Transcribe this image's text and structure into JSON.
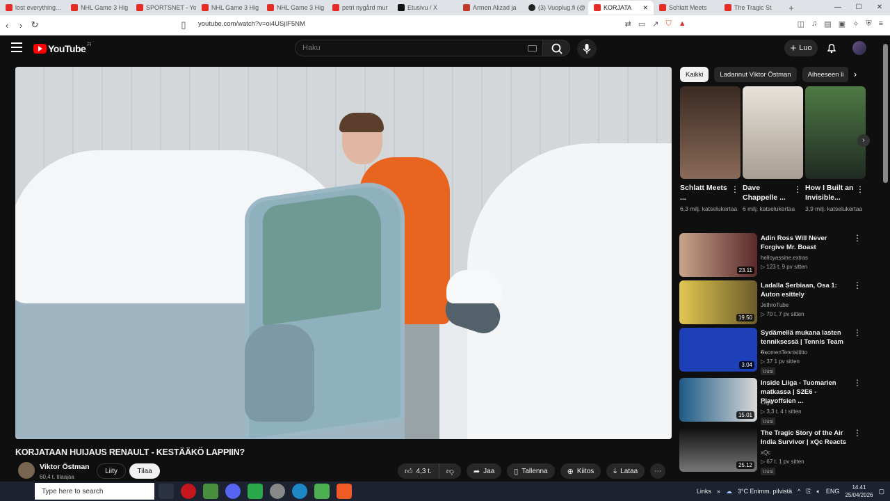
{
  "browser": {
    "tabs": [
      {
        "label": "lost everything...",
        "icon": "youtube-icon"
      },
      {
        "label": "NHL Game 3 Hig",
        "icon": "youtube-icon"
      },
      {
        "label": "SPORTSNET - You",
        "icon": "youtube-icon"
      },
      {
        "label": "NHL Game 3 Hig",
        "icon": "youtube-icon"
      },
      {
        "label": "NHL Game 3 Hig",
        "icon": "youtube-icon"
      },
      {
        "label": "petri nygård mur",
        "icon": "youtube-icon"
      },
      {
        "label": "Etusivu / X",
        "icon": "x-icon"
      },
      {
        "label": "Armen Alizad ja",
        "icon": "a-icon"
      },
      {
        "label": "(3) Vuoplug.fi (@",
        "icon": "tiktok-icon"
      },
      {
        "label": "KORJATA",
        "icon": "youtube-icon",
        "active": true
      },
      {
        "label": "Schlatt Meets",
        "icon": "youtube-icon"
      },
      {
        "label": "The Tragic St",
        "icon": "youtube-icon"
      }
    ],
    "url": "youtube.com/watch?v=oi4USjIF5NM"
  },
  "header": {
    "logo_text": "YouTube",
    "country_code": "FI",
    "search_placeholder": "Haku",
    "create_label": "Luo"
  },
  "video": {
    "title": "KORJATAAN HUIJAUS RENAULT - KESTÄÄKÖ LAPPIIN?",
    "channel": "Viktor Östman",
    "subscribers": "60,4 t. tilaajaa",
    "join_label": "Liity",
    "subscribe_label": "Tilaa",
    "likes": "4,3 t.",
    "share_label": "Jaa",
    "save_label": "Tallenna",
    "thanks_label": "Kiitos",
    "download_label": "Lataa"
  },
  "chips": [
    "Kaikki",
    "Ladannut Viktor Östman",
    "Aiheeseen li"
  ],
  "shorts": [
    {
      "title": "Schlatt Meets ...",
      "views": "6,3 milj. katselukertaa",
      "color": "#6b4a3a"
    },
    {
      "title": "Dave Chappelle ...",
      "views": "6 milj. katselukertaa",
      "color": "#d9d4cc"
    },
    {
      "title": "How I Built an Invisible...",
      "views": "3,9 milj. katselukertaa",
      "color": "#3c5a3a"
    }
  ],
  "recommendations": [
    {
      "title": "Adin Ross Will Never Forgive Mr. Boast",
      "channel": "helloyassine.extras",
      "meta": "▷ 123 t.  9 pv sitten",
      "duration": "23.11",
      "badge": "",
      "color": "#5a2a2a"
    },
    {
      "title": "Ladalla Serbiaan, Osa 1: Auton esittely",
      "channel": "JethroTube",
      "meta": "▷ 70 t.  7 pv sitten",
      "duration": "19.50",
      "badge": "",
      "color": "#c9b24a"
    },
    {
      "title": "Sydämellä mukana lasten tenniksessä | Tennis Team ...",
      "channel": "SuomenTennisliitto",
      "meta": "▷ 37  1 pv sitten",
      "duration": "3.04",
      "badge": "Uusi",
      "color": "#1d3fb8"
    },
    {
      "title": "Inside Liiga - Tuomarien matkassa | S2E6 - Playoffsien ...",
      "channel": "Liiga",
      "meta": "▷ 3,3 t.  4 t sitten",
      "duration": "15.01",
      "badge": "Uusi",
      "color": "#1a4a6a"
    },
    {
      "title": "The Tragic Story of the Air India Survivor | xQc Reacts",
      "channel": "xQc",
      "meta": "▷ 67 t.  1 pv sitten",
      "duration": "25.12",
      "badge": "Uusi",
      "color": "#3a3a3a"
    }
  ],
  "taskbar": {
    "search_placeholder": "Type here to search",
    "links_label": "Links",
    "weather": "3°C  Enimm. pilvistä",
    "language": "ENG",
    "time": "14.41",
    "date": "25/04/2026"
  }
}
